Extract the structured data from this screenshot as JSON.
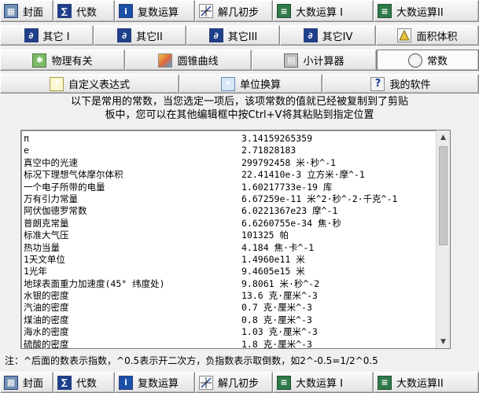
{
  "tabs_row1": [
    {
      "label": "封面",
      "icon": "cover-icon"
    },
    {
      "label": "代数",
      "icon": "algebra-icon"
    },
    {
      "label": "复数运算",
      "icon": "complex-icon"
    },
    {
      "label": "解几初步",
      "icon": "analytic-geometry-icon"
    },
    {
      "label": "大数运算 I",
      "icon": "big-number-icon"
    },
    {
      "label": "大数运算II",
      "icon": "big-number-icon"
    }
  ],
  "tabs_row2": [
    {
      "label": "其它 I",
      "icon": "other-icon"
    },
    {
      "label": "其它II",
      "icon": "other-icon"
    },
    {
      "label": "其它III",
      "icon": "other-icon"
    },
    {
      "label": "其它IV",
      "icon": "other-icon"
    },
    {
      "label": "面积体积",
      "icon": "area-volume-icon"
    }
  ],
  "tabs_row3": [
    {
      "label": "物理有关",
      "icon": "physics-icon"
    },
    {
      "label": "圆锥曲线",
      "icon": "conic-icon"
    },
    {
      "label": "小计算器",
      "icon": "calculator-icon"
    },
    {
      "label": "常数",
      "icon": "constants-icon"
    }
  ],
  "tabs_row4": [
    {
      "label": "自定义表达式",
      "icon": "expression-icon"
    },
    {
      "label": "单位换算",
      "icon": "unit-convert-icon"
    },
    {
      "label": "我的软件",
      "icon": "help-icon"
    }
  ],
  "description": {
    "line1": "以下是常用的常数，当您选定一项后，该项常数的值就已经被复制到了剪贴",
    "line2": "板中，您可以在其他编辑框中按Ctrl+V将其粘贴到指定位置"
  },
  "constants": [
    {
      "name": "π",
      "value": "3.14159265359"
    },
    {
      "name": "e",
      "value": "2.71828183"
    },
    {
      "name": "真空中的光速",
      "value": "299792458 米·秒^-1"
    },
    {
      "name": "标况下理想气体摩尔体积",
      "value": "22.41410e-3 立方米·摩^-1"
    },
    {
      "name": "一个电子所带的电量",
      "value": "1.60217733e-19 库"
    },
    {
      "name": "万有引力常量",
      "value": "6.67259e-11 米^2·秒^-2·千克^-1"
    },
    {
      "name": "阿伏伽德罗常数",
      "value": "6.0221367e23 摩^-1"
    },
    {
      "name": "普朗克常量",
      "value": "6.6260755e-34 焦·秒"
    },
    {
      "name": "标准大气压",
      "value": "101325 帕"
    },
    {
      "name": "热功当量",
      "value": "4.184 焦·卡^-1"
    },
    {
      "name": "1天文单位",
      "value": "1.4960e11 米"
    },
    {
      "name": "1光年",
      "value": "9.4605e15 米"
    },
    {
      "name": "地球表面重力加速度(45° 纬度处)",
      "value": "9.8061 米·秒^-2"
    },
    {
      "name": "水银的密度",
      "value": "13.6 克·厘米^-3"
    },
    {
      "name": "汽油的密度",
      "value": "0.7 克·厘米^-3"
    },
    {
      "name": "煤油的密度",
      "value": "0.8 克·厘米^-3"
    },
    {
      "name": "海水的密度",
      "value": "1.03 克·厘米^-3"
    },
    {
      "name": "硫酸的密度",
      "value": "1.8 克·厘米^-3"
    }
  ],
  "note": "注：^后面的数表示指数，^0.5表示开二次方，负指数表示取倒数，如2^-0.5=1/2^0.5"
}
